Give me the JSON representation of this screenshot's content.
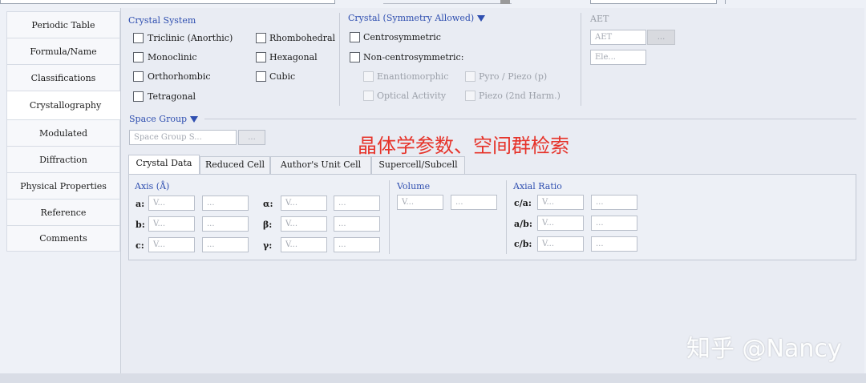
{
  "sidebar": {
    "items": [
      {
        "label": "Periodic Table"
      },
      {
        "label": "Formula/Name"
      },
      {
        "label": "Classifications"
      },
      {
        "label": "Crystallography"
      },
      {
        "label": "Modulated"
      },
      {
        "label": "Diffraction"
      },
      {
        "label": "Physical Properties"
      },
      {
        "label": "Reference"
      },
      {
        "label": "Comments"
      }
    ],
    "active_index": 3
  },
  "crystal_system": {
    "title": "Crystal System",
    "options": [
      {
        "label": "Triclinic (Anorthic)"
      },
      {
        "label": "Rhombohedral"
      },
      {
        "label": "Monoclinic"
      },
      {
        "label": "Hexagonal"
      },
      {
        "label": "Orthorhombic"
      },
      {
        "label": "Cubic"
      },
      {
        "label": "Tetragonal"
      }
    ]
  },
  "symmetry": {
    "title": "Crystal (Symmetry Allowed)",
    "centro": "Centrosymmetric",
    "noncentro": "Non-centrosymmetric:",
    "enantiomorphic": "Enantiomorphic",
    "pyro": "Pyro / Piezo (p)",
    "optical": "Optical Activity",
    "piezo2": "Piezo (2nd Harm.)"
  },
  "aet": {
    "title": "AET",
    "input_placeholder": "AET",
    "button": "...",
    "ele_placeholder": "Ele..."
  },
  "space_group": {
    "title": "Space Group",
    "placeholder": "Space Group S...",
    "button": "..."
  },
  "annotation": "晶体学参数、空间群检索",
  "tabs": [
    {
      "label": "Crystal Data"
    },
    {
      "label": "Reduced Cell"
    },
    {
      "label": "Author's Unit Cell"
    },
    {
      "label": "Supercell/Subcell"
    }
  ],
  "crystal_data": {
    "axis_title": "Axis (Å)",
    "axis_a": "a:",
    "axis_b": "b:",
    "axis_c": "c:",
    "alpha": "α:",
    "beta": "β:",
    "gamma": "γ:",
    "volume_title": "Volume",
    "axial_title": "Axial Ratio",
    "ca": "c/a:",
    "ab": "a/b:",
    "cb": "c/b:",
    "value_placeholder": "V...",
    "range_placeholder": "..."
  },
  "watermark": "知乎 @Nancy"
}
